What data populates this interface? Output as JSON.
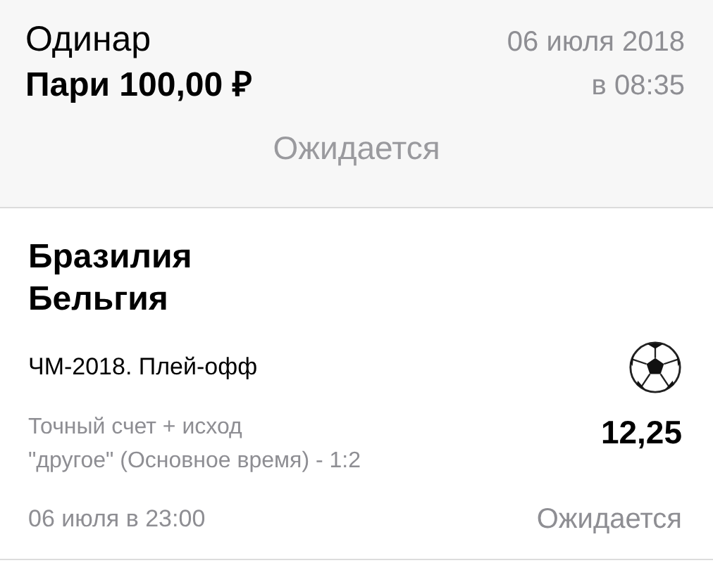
{
  "bet": {
    "type": "Одинар",
    "stake": "Пари 100,00 ₽",
    "date": "06 июля 2018",
    "time": "в 08:35",
    "status": "Ожидается"
  },
  "event": {
    "team_1": "Бразилия",
    "team_2": "Бельгия",
    "tournament": "ЧМ-2018. Плей-офф",
    "market": "Точный счет + исход\n\"другое\" (Основное время) - 1:2",
    "odds": "12,25",
    "start": "06 июля в 23:00",
    "status": "Ожидается"
  }
}
